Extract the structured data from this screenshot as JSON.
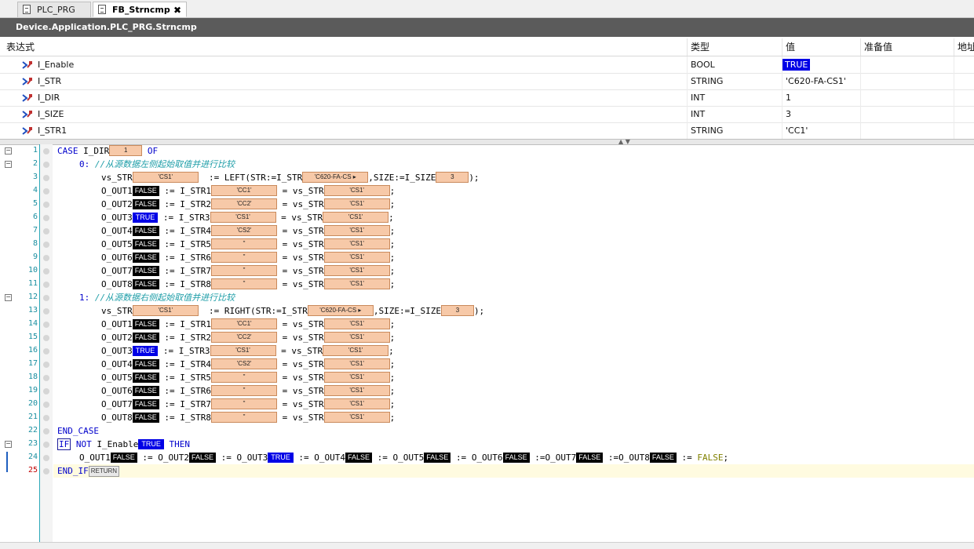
{
  "tabs": [
    {
      "label": "PLC_PRG"
    },
    {
      "label": "FB_Strncmp",
      "close": "✖"
    }
  ],
  "path": "Device.Application.PLC_PRG.Strncmp",
  "watch": {
    "headers": [
      "表达式",
      "类型",
      "值",
      "准备值",
      "地址"
    ],
    "rows": [
      {
        "name": "I_Enable",
        "type": "BOOL",
        "value": "TRUE"
      },
      {
        "name": "I_STR",
        "type": "STRING",
        "value": "'C620-FA-CS1'"
      },
      {
        "name": "I_DIR",
        "type": "INT",
        "value": "1"
      },
      {
        "name": "I_SIZE",
        "type": "INT",
        "value": "3"
      },
      {
        "name": "I_STR1",
        "type": "STRING",
        "value": "'CC1'"
      }
    ]
  },
  "code": {
    "line_numbers": [
      "1",
      "2",
      "3",
      "4",
      "5",
      "6",
      "7",
      "8",
      "9",
      "10",
      "11",
      "12",
      "13",
      "14",
      "15",
      "16",
      "17",
      "18",
      "19",
      "20",
      "21",
      "22",
      "23",
      "24",
      "25"
    ],
    "case": "CASE",
    "i_dir": "I_DIR",
    "i_dir_val": "1",
    "of": "OF",
    "branch0": "0:",
    "comment0": "//从源数据左侧起始取值并进行比较",
    "branch1": "1:",
    "comment1": "//从源数据右侧起始取值并进行比较",
    "vs_str": "vs_STR",
    "vs_str_val": "'CS1'",
    "assign": ":=",
    "left": "LEFT(STR:=I_STR",
    "right": "RIGHT(STR:=I_STR",
    "str_val": "'C620-FA-CS",
    "size": ",SIZE:=I_SIZE",
    "size_val": "3",
    "close": ");",
    "eq": "=",
    "semi": ";",
    "outputs": [
      {
        "out": "O_OUT1",
        "state": "FALSE",
        "str": "I_STR1",
        "str_val": "'CC1'"
      },
      {
        "out": "O_OUT2",
        "state": "FALSE",
        "str": "I_STR2",
        "str_val": "'CC2'"
      },
      {
        "out": "O_OUT3",
        "state": "TRUE",
        "str": "I_STR3",
        "str_val": "'CS1'"
      },
      {
        "out": "O_OUT4",
        "state": "FALSE",
        "str": "I_STR4",
        "str_val": "'CS2'"
      },
      {
        "out": "O_OUT5",
        "state": "FALSE",
        "str": "I_STR5",
        "str_val": "''"
      },
      {
        "out": "O_OUT6",
        "state": "FALSE",
        "str": "I_STR6",
        "str_val": "''"
      },
      {
        "out": "O_OUT7",
        "state": "FALSE",
        "str": "I_STR7",
        "str_val": "''"
      },
      {
        "out": "O_OUT8",
        "state": "FALSE",
        "str": "I_STR8",
        "str_val": "''"
      }
    ],
    "end_case": "END_CASE",
    "if": "IF",
    "not": "NOT",
    "i_enable": "I_Enable",
    "i_enable_val": "TRUE",
    "then": "THEN",
    "assign_sep": ":=",
    "false_kw": "FALSE",
    "end_if": "END_IF",
    "return": "RETURN"
  }
}
